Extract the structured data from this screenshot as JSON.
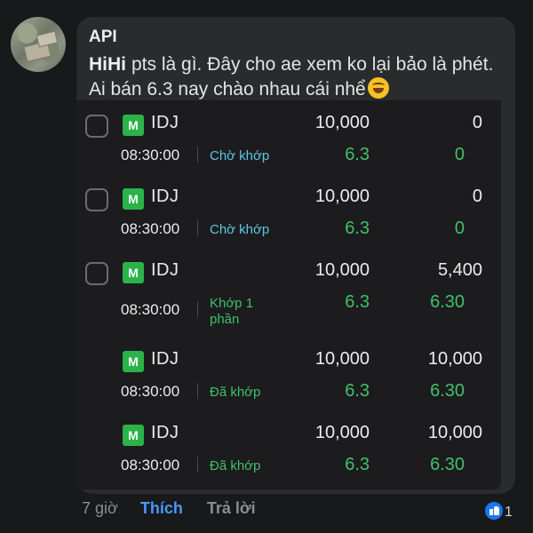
{
  "comment": {
    "author": "API",
    "mention": "HiHi",
    "text": "pts là gì. Đây cho ae xem ko lại bảo là phét. Ai bán 6.3 nay chào nhau cái nhể",
    "emoji": "rolling-on-floor-laughing-emoji"
  },
  "orders": [
    {
      "has_checkbox": true,
      "badge": "M",
      "ticker": "IDJ",
      "quantity": "10,000",
      "filled": "0",
      "time": "08:30:00",
      "status": "Chờ khớp",
      "status_type": "wait",
      "price": "6.3",
      "matched_price": "0"
    },
    {
      "has_checkbox": true,
      "badge": "M",
      "ticker": "IDJ",
      "quantity": "10,000",
      "filled": "0",
      "time": "08:30:00",
      "status": "Chờ khớp",
      "status_type": "wait",
      "price": "6.3",
      "matched_price": "0"
    },
    {
      "has_checkbox": true,
      "badge": "M",
      "ticker": "IDJ",
      "quantity": "10,000",
      "filled": "5,400",
      "time": "08:30:00",
      "status": "Khớp 1 phần",
      "status_type": "done",
      "price": "6.3",
      "matched_price": "6.30"
    },
    {
      "has_checkbox": false,
      "badge": "M",
      "ticker": "IDJ",
      "quantity": "10,000",
      "filled": "10,000",
      "time": "08:30:00",
      "status": "Đã khớp",
      "status_type": "done",
      "price": "6.3",
      "matched_price": "6.30"
    },
    {
      "has_checkbox": false,
      "badge": "M",
      "ticker": "IDJ",
      "quantity": "10,000",
      "filled": "10,000",
      "time": "08:30:00",
      "status": "Đã khớp",
      "status_type": "done",
      "price": "6.3",
      "matched_price": "6.30"
    }
  ],
  "footer": {
    "time_ago": "7 giờ",
    "like_label": "Thích",
    "reply_label": "Trả lời",
    "reaction_count": "1",
    "reaction_icon": "thumbs-up-icon"
  },
  "colors": {
    "background": "#18191a",
    "bubble": "#2a2b2d",
    "accent_green": "#3ec16a",
    "accent_cyan": "#5fc7e0",
    "like_blue": "#4599ff"
  }
}
